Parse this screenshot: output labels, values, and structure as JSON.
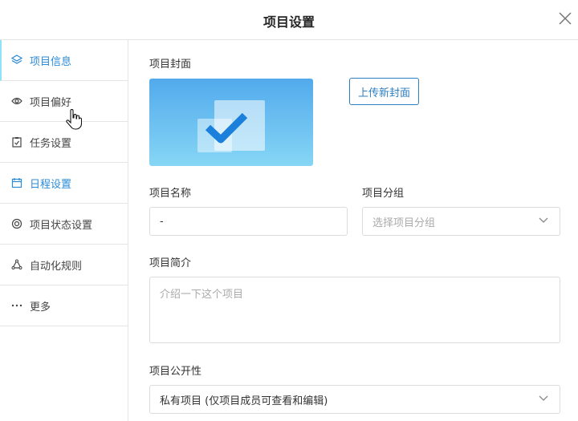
{
  "header": {
    "title": "项目设置"
  },
  "sidebar": {
    "items": [
      {
        "label": "项目信息",
        "icon": "layers-icon"
      },
      {
        "label": "项目偏好",
        "icon": "eye-icon"
      },
      {
        "label": "任务设置",
        "icon": "clipboard-icon"
      },
      {
        "label": "日程设置",
        "icon": "calendar-icon"
      },
      {
        "label": "项目状态设置",
        "icon": "status-icon"
      },
      {
        "label": "自动化规则",
        "icon": "automation-icon"
      },
      {
        "label": "更多",
        "icon": "more-icon"
      }
    ]
  },
  "main": {
    "cover_label": "项目封面",
    "upload_button": "上传新封面",
    "name_label": "项目名称",
    "name_value": "-",
    "group_label": "项目分组",
    "group_placeholder": "选择项目分组",
    "desc_label": "项目简介",
    "desc_placeholder": "介绍一下这个项目",
    "visibility_label": "项目公开性",
    "visibility_value": "私有项目 (仅项目成员可查看和编辑)"
  },
  "colors": {
    "accent": "#2b8bd6",
    "button": "#2d7fc1"
  }
}
